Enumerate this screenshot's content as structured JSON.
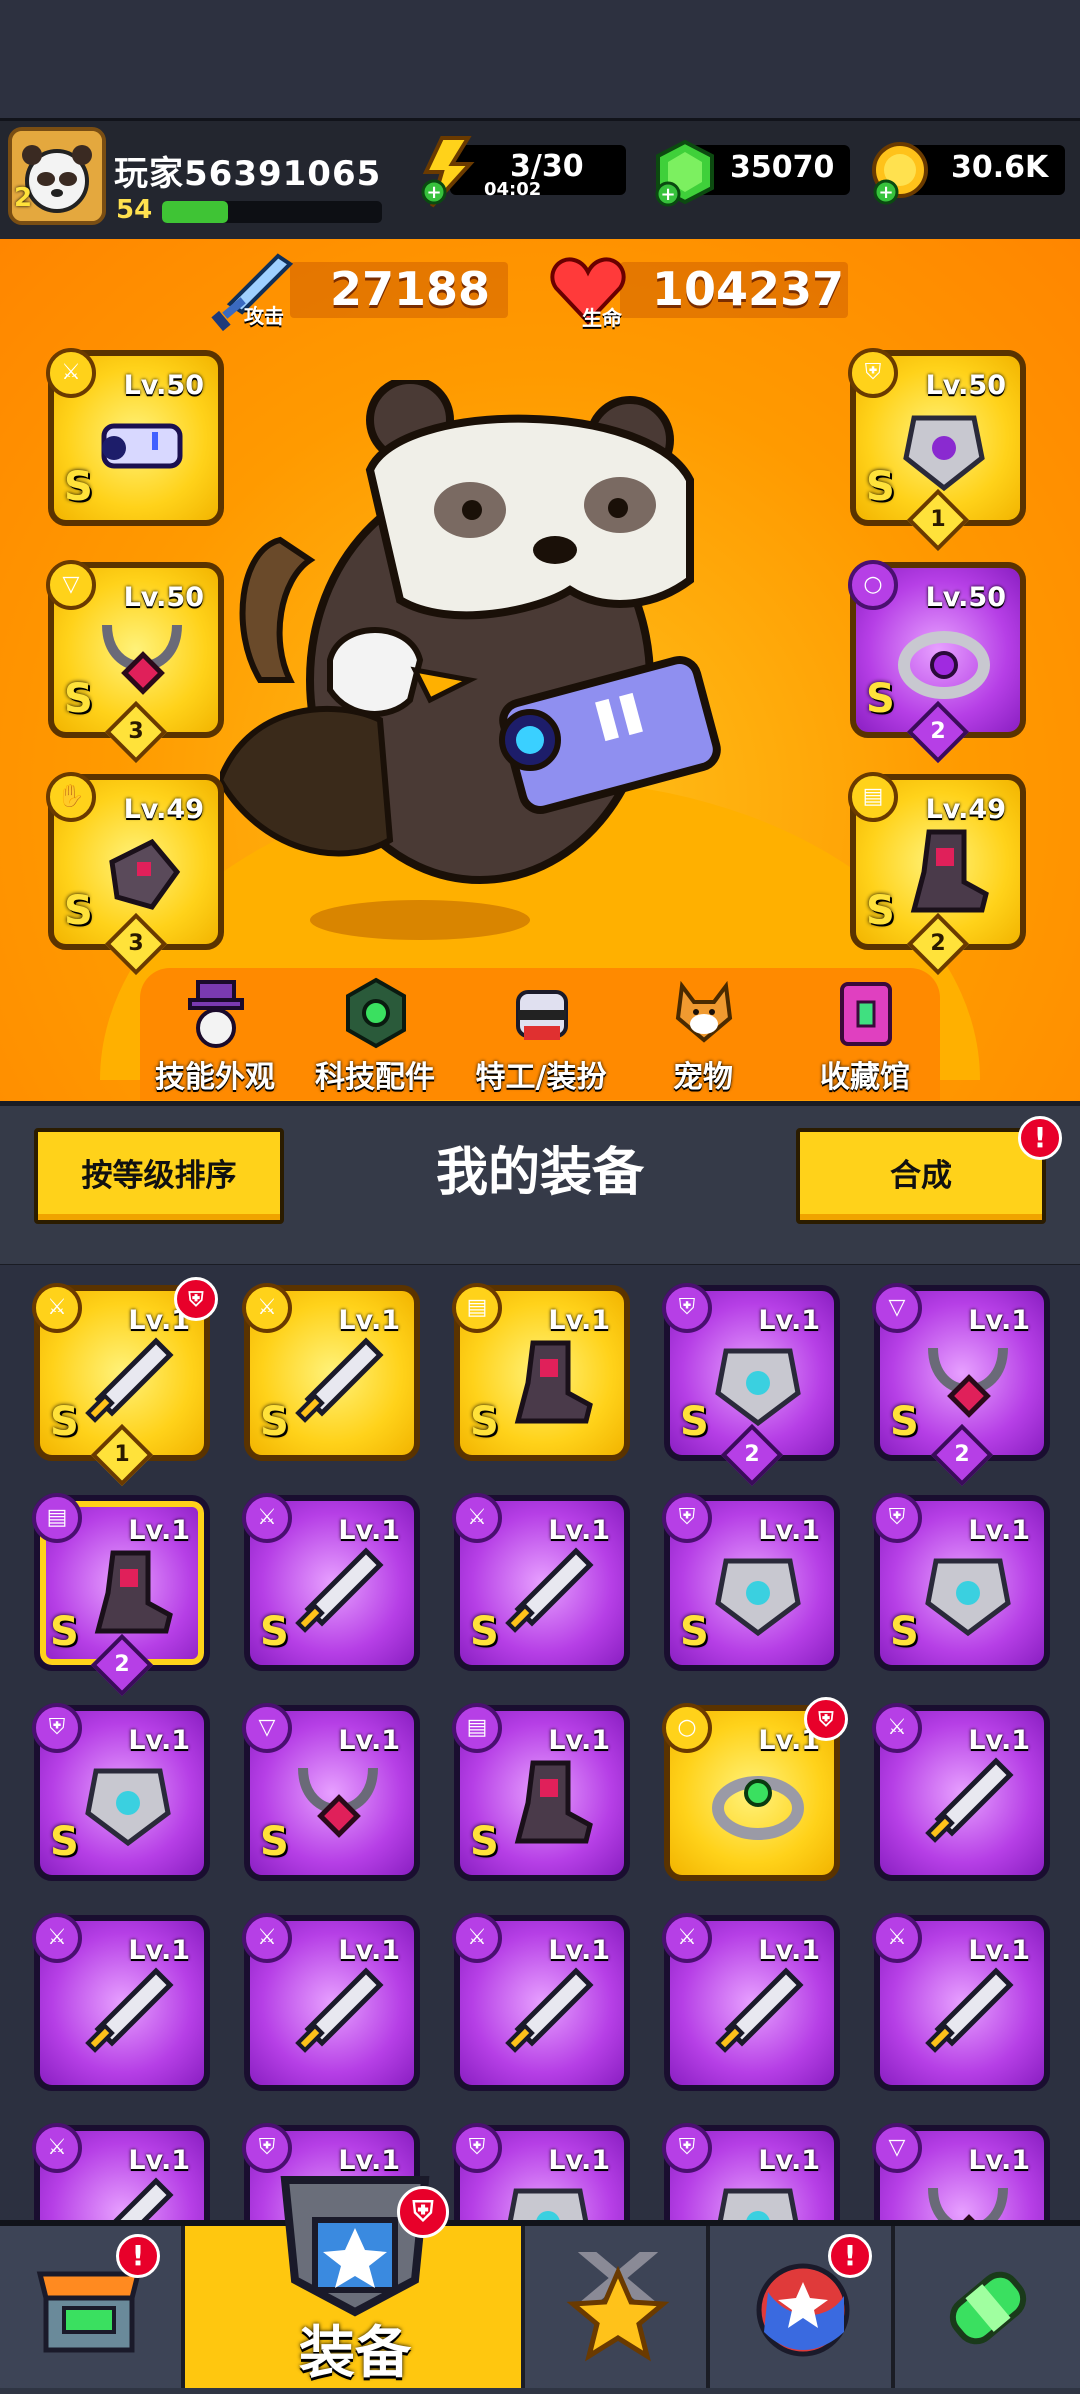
{
  "player": {
    "name": "玩家56391065",
    "level": "54",
    "xp_fraction": 0.3,
    "avatar_rank": "2"
  },
  "currency": {
    "energy": "3/30",
    "energy_timer": "04:02",
    "gems": "35070",
    "gold": "30.6K"
  },
  "stats": {
    "attack_label": "攻击",
    "attack_value": "27188",
    "hp_label": "生命",
    "hp_value": "104237"
  },
  "gear_slots": [
    {
      "level": "Lv.50",
      "grade": "S",
      "rarity": "gold",
      "type_icon": "sword-icon",
      "rank": ""
    },
    {
      "level": "Lv.50",
      "grade": "S",
      "rarity": "gold",
      "type_icon": "armor-icon",
      "rank": "1"
    },
    {
      "level": "Lv.50",
      "grade": "S",
      "rarity": "gold",
      "type_icon": "necklace-icon",
      "rank": "3"
    },
    {
      "level": "Lv.50",
      "grade": "S",
      "rarity": "purple",
      "type_icon": "ring-icon",
      "rank": "2"
    },
    {
      "level": "Lv.49",
      "grade": "S",
      "rarity": "gold",
      "type_icon": "glove-icon",
      "rank": "3"
    },
    {
      "level": "Lv.49",
      "grade": "S",
      "rarity": "gold",
      "type_icon": "boot-icon",
      "rank": "2"
    }
  ],
  "categories": [
    {
      "label": "技能外观",
      "icon": "skill-skin-icon"
    },
    {
      "label": "科技配件",
      "icon": "tech-part-icon"
    },
    {
      "label": "特工/装扮",
      "icon": "agent-costume-icon"
    },
    {
      "label": "宠物",
      "icon": "pet-icon"
    },
    {
      "label": "收藏馆",
      "icon": "collection-icon"
    }
  ],
  "toolbar": {
    "sort_label": "按等级排序",
    "title": "我的装备",
    "merge_label": "合成",
    "merge_badge": "!"
  },
  "inventory": [
    {
      "level": "Lv.1",
      "grade": "S",
      "rarity": "gold",
      "type_icon": "sword-icon",
      "rank": "1",
      "badge": "new"
    },
    {
      "level": "Lv.1",
      "grade": "S",
      "rarity": "gold",
      "type_icon": "sword-icon",
      "rank": "",
      "badge": ""
    },
    {
      "level": "Lv.1",
      "grade": "S",
      "rarity": "gold",
      "type_icon": "boot-icon",
      "rank": "",
      "badge": ""
    },
    {
      "level": "Lv.1",
      "grade": "S",
      "rarity": "purple",
      "type_icon": "armor-icon",
      "rank": "2",
      "badge": ""
    },
    {
      "level": "Lv.1",
      "grade": "S",
      "rarity": "purple",
      "type_icon": "necklace-icon",
      "rank": "2",
      "badge": ""
    },
    {
      "level": "Lv.1",
      "grade": "S",
      "rarity": "purple-gold",
      "type_icon": "boot-icon",
      "rank": "2",
      "badge": ""
    },
    {
      "level": "Lv.1",
      "grade": "S",
      "rarity": "purple",
      "type_icon": "sword-icon",
      "rank": "",
      "badge": ""
    },
    {
      "level": "Lv.1",
      "grade": "S",
      "rarity": "purple",
      "type_icon": "sword-icon",
      "rank": "",
      "badge": ""
    },
    {
      "level": "Lv.1",
      "grade": "S",
      "rarity": "purple",
      "type_icon": "armor-icon",
      "rank": "",
      "badge": ""
    },
    {
      "level": "Lv.1",
      "grade": "S",
      "rarity": "purple",
      "type_icon": "armor-icon",
      "rank": "",
      "badge": ""
    },
    {
      "level": "Lv.1",
      "grade": "S",
      "rarity": "purple",
      "type_icon": "armor-icon",
      "rank": "",
      "badge": ""
    },
    {
      "level": "Lv.1",
      "grade": "S",
      "rarity": "purple",
      "type_icon": "necklace-icon",
      "rank": "",
      "badge": ""
    },
    {
      "level": "Lv.1",
      "grade": "S",
      "rarity": "purple",
      "type_icon": "boot-icon",
      "rank": "",
      "badge": ""
    },
    {
      "level": "Lv.1",
      "grade": "",
      "rarity": "gold",
      "type_icon": "ring-icon",
      "rank": "",
      "badge": "new"
    },
    {
      "level": "Lv.1",
      "grade": "",
      "rarity": "purple",
      "type_icon": "sword-icon",
      "rank": "",
      "badge": ""
    },
    {
      "level": "Lv.1",
      "grade": "",
      "rarity": "purple",
      "type_icon": "sword-icon",
      "rank": "",
      "badge": ""
    },
    {
      "level": "Lv.1",
      "grade": "",
      "rarity": "purple",
      "type_icon": "sword-icon",
      "rank": "",
      "badge": ""
    },
    {
      "level": "Lv.1",
      "grade": "",
      "rarity": "purple",
      "type_icon": "sword-icon",
      "rank": "",
      "badge": ""
    },
    {
      "level": "Lv.1",
      "grade": "",
      "rarity": "purple",
      "type_icon": "sword-icon",
      "rank": "",
      "badge": ""
    },
    {
      "level": "Lv.1",
      "grade": "",
      "rarity": "purple",
      "type_icon": "sword-icon",
      "rank": "",
      "badge": ""
    },
    {
      "level": "Lv.1",
      "grade": "",
      "rarity": "purple",
      "type_icon": "sword-icon",
      "rank": "",
      "badge": ""
    },
    {
      "level": "Lv.1",
      "grade": "",
      "rarity": "purple",
      "type_icon": "armor-icon",
      "rank": "",
      "badge": ""
    },
    {
      "level": "Lv.1",
      "grade": "",
      "rarity": "purple",
      "type_icon": "armor-icon",
      "rank": "",
      "badge": ""
    },
    {
      "level": "Lv.1",
      "grade": "",
      "rarity": "purple",
      "type_icon": "armor-icon",
      "rank": "",
      "badge": ""
    },
    {
      "level": "Lv.1",
      "grade": "",
      "rarity": "purple",
      "type_icon": "necklace-icon",
      "rank": "",
      "badge": ""
    }
  ],
  "bottom_nav": [
    {
      "label": "",
      "icon": "shop-icon",
      "badge": "!"
    },
    {
      "label": "装备",
      "icon": "equipment-icon",
      "badge": "new",
      "active": true
    },
    {
      "label": "",
      "icon": "battle-icon",
      "badge": ""
    },
    {
      "label": "",
      "icon": "events-icon",
      "badge": "!"
    },
    {
      "label": "",
      "icon": "evolution-icon",
      "badge": ""
    }
  ],
  "colors": {
    "accent": "#ffd21a",
    "hero_bg": "#ff9a00",
    "epic": "#b63fe6",
    "legendary": "#ffd21a",
    "badge": "#e8002a"
  }
}
